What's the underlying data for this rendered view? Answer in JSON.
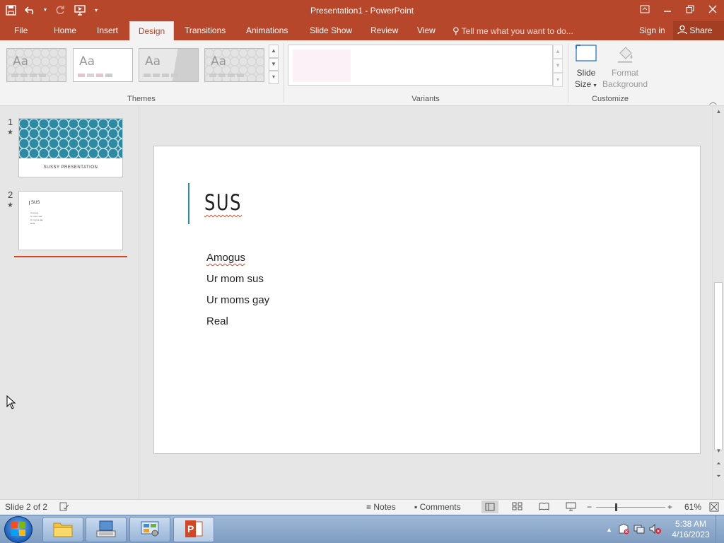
{
  "window": {
    "title": "Presentation1 - PowerPoint"
  },
  "quick_access": {
    "save": "save-icon",
    "undo": "undo-icon",
    "redo": "redo-icon",
    "start_from_beginning": "slideshow-icon",
    "customize": "dropdown-icon"
  },
  "tabs": [
    {
      "label": "File",
      "active": false
    },
    {
      "label": "Home",
      "active": false
    },
    {
      "label": "Insert",
      "active": false
    },
    {
      "label": "Design",
      "active": true
    },
    {
      "label": "Transitions",
      "active": false
    },
    {
      "label": "Animations",
      "active": false
    },
    {
      "label": "Slide Show",
      "active": false
    },
    {
      "label": "Review",
      "active": false
    },
    {
      "label": "View",
      "active": false
    }
  ],
  "tell_me": "Tell me what you want to do...",
  "sign_in": "Sign in",
  "share": "Share",
  "ribbon": {
    "themes": {
      "label": "Themes",
      "items": [
        "Aa",
        "Aa",
        "Aa",
        "Aa"
      ]
    },
    "variants": {
      "label": "Variants"
    },
    "customize": {
      "label": "Customize",
      "slide_size": "Slide",
      "slide_size_line2": "Size",
      "format_background": "Format",
      "format_background_line2": "Background"
    }
  },
  "slides_panel": {
    "slides": [
      {
        "number": "1",
        "caption": "SUSSY PRESENTATION"
      },
      {
        "number": "2",
        "title": "SUS"
      }
    ]
  },
  "slide": {
    "title": "SUS",
    "bullets": [
      "Amogus",
      "Ur mom sus",
      "Ur moms gay",
      "Real"
    ]
  },
  "status": {
    "slide_indicator": "Slide 2 of 2",
    "notes": "Notes",
    "comments": "Comments",
    "zoom": "61%",
    "zoom_minus": "−",
    "zoom_plus": "+"
  },
  "taskbar": {
    "time": "5:38 AM",
    "date": "4/16/2023"
  },
  "colors": {
    "accent": "#b7472a",
    "theme_teal": "#2c8aa2",
    "spell_error": "#d24726"
  }
}
